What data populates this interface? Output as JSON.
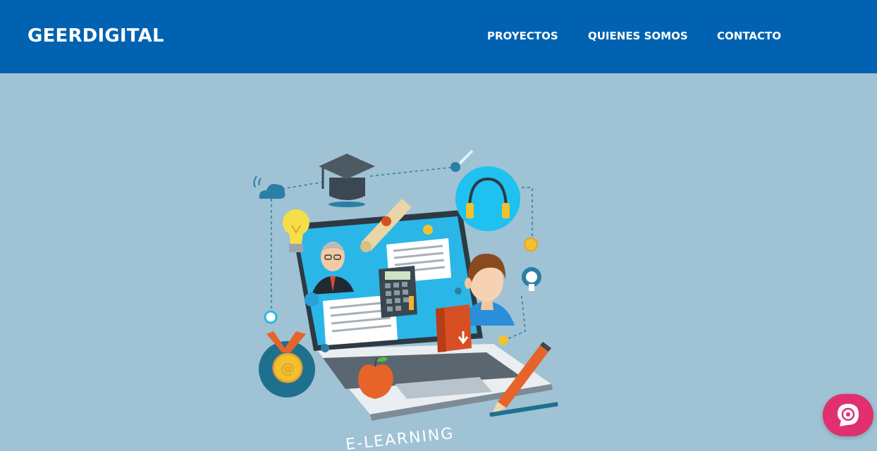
{
  "header": {
    "brand": "GEERDIGITAL",
    "nav": [
      {
        "label": "PROYECTOS"
      },
      {
        "label": "QUIENES SOMOS"
      },
      {
        "label": "CONTACTO"
      }
    ]
  },
  "hero": {
    "illustration_caption": "E-LEARNING",
    "icons": [
      "cloud-icon",
      "graduation-cap-icon",
      "diploma-icon",
      "lightbulb-icon",
      "headphones-icon",
      "teacher-avatar-icon",
      "student-avatar-icon",
      "calculator-icon",
      "book-download-icon",
      "apple-icon",
      "medal-icon",
      "pencil-icon",
      "laptop-icon"
    ]
  },
  "chat_widget": {
    "icon": "chat-bubble-icon"
  },
  "colors": {
    "navbar": "#0062b0",
    "background": "#9fc2d5",
    "chat_button": "#e0306f",
    "accent_cyan": "#2bb6e8",
    "accent_orange": "#e6642a"
  }
}
